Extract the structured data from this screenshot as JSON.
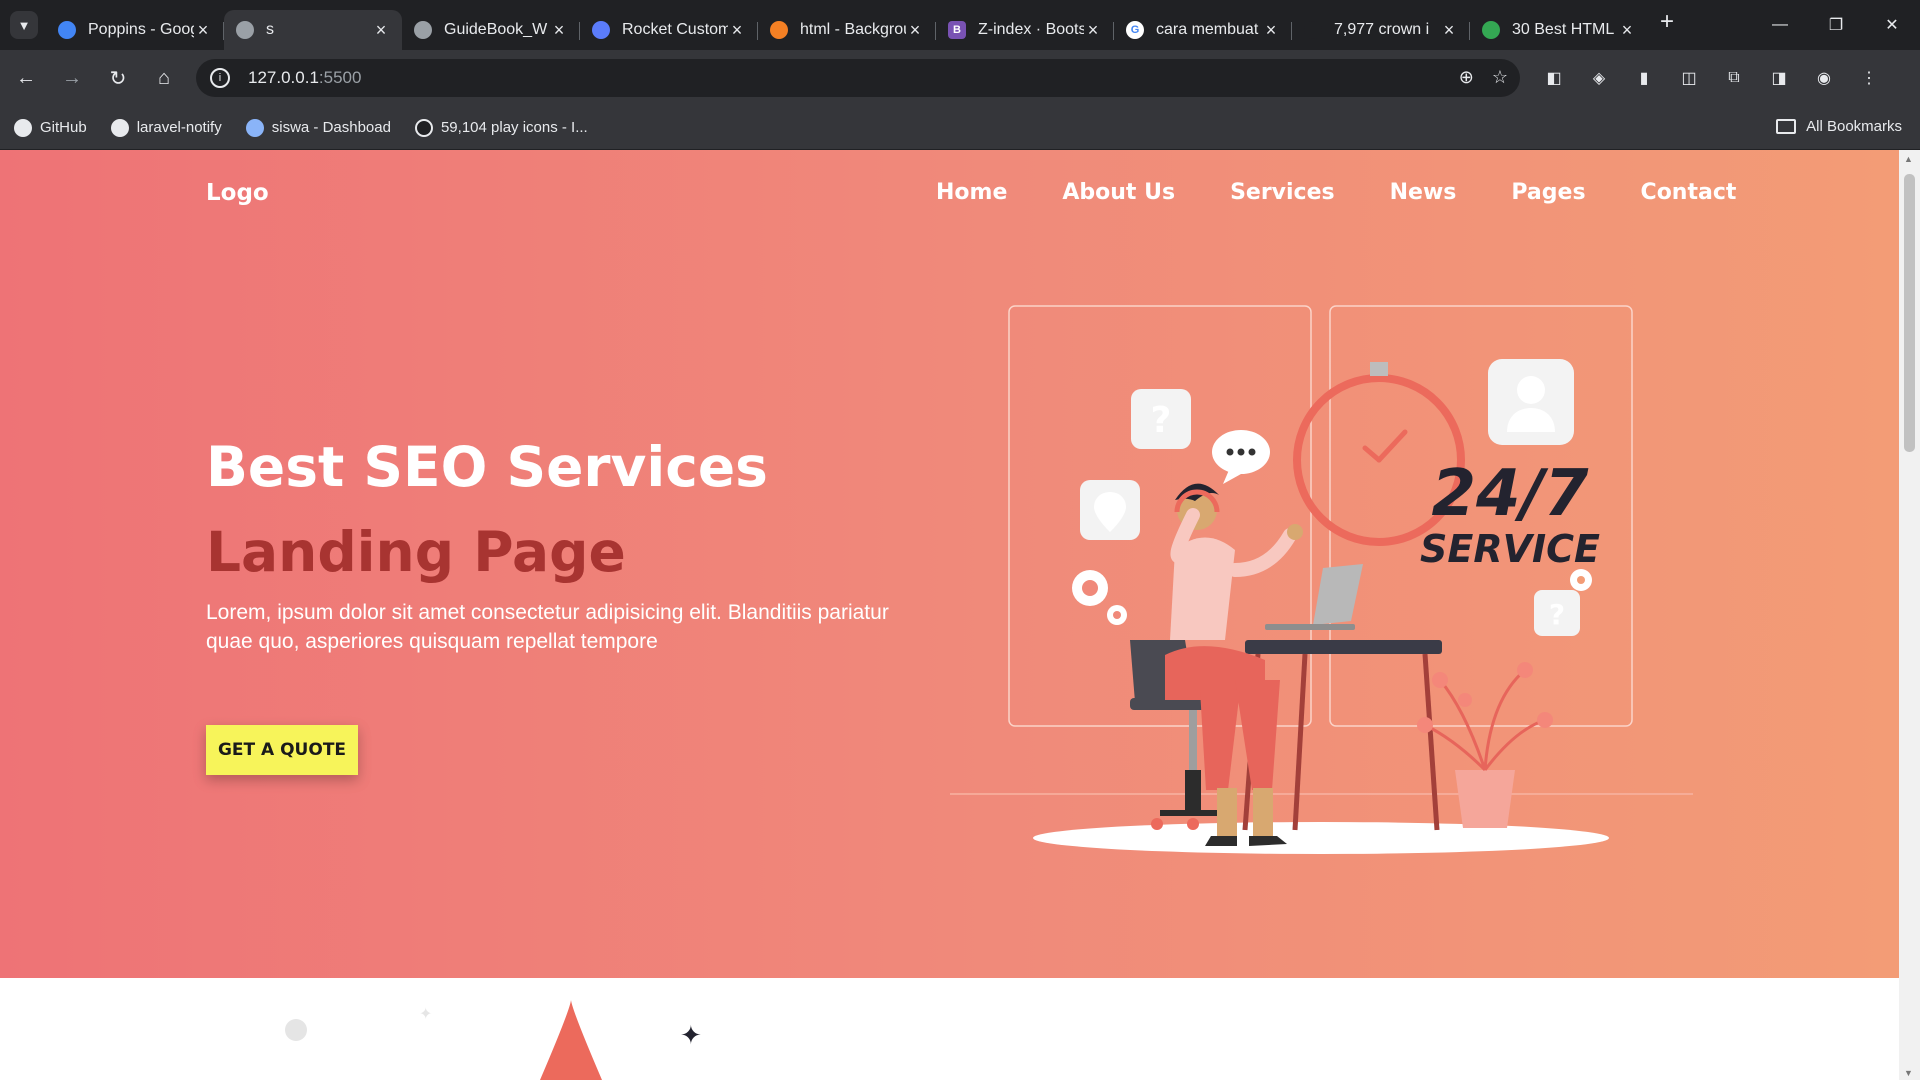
{
  "browser": {
    "tabs": [
      {
        "title": "Poppins - Google Fonts",
        "icon": "google-fonts-icon",
        "color": "#4285f4"
      },
      {
        "title": "s",
        "icon": "globe-icon",
        "color": "#9aa0a6",
        "active": true
      },
      {
        "title": "GuideBook_W",
        "icon": "globe-icon",
        "color": "#9aa0a6"
      },
      {
        "title": "Rocket Custom",
        "icon": "rocket-icon",
        "color": "#5b7cfa"
      },
      {
        "title": "html - Background",
        "icon": "stackoverflow-icon",
        "color": "#f48024"
      },
      {
        "title": "Z-index · Bootstrap",
        "icon": "bootstrap-icon",
        "color": "#7952b3"
      },
      {
        "title": "cara membuat",
        "icon": "google-icon",
        "color": "#ffffff"
      },
      {
        "title": "7,977 crown i",
        "icon": "crown-icon",
        "color": "#202124"
      },
      {
        "title": "30 Best HTML",
        "icon": "colorlib-icon",
        "color": "#34a853"
      }
    ],
    "url_host": "127.0.0.1",
    "url_port": ":5500",
    "bookmarks": [
      "GitHub",
      "laravel-notify",
      "siswa - Dashboad",
      "59,104 play icons - I..."
    ],
    "all_bookmarks": "All Bookmarks"
  },
  "site": {
    "logo": "Logo",
    "nav": [
      "Home",
      "About Us",
      "Services",
      "News",
      "Pages",
      "Contact"
    ],
    "headline": "Best SEO Services",
    "headline_accent": "Landing Page",
    "lead": "Lorem, ipsum dolor sit amet consectetur adipisicing elit. Blanditiis pariatur quae quo, asperiores quisquam repellat tempore",
    "cta": "GET A QUOTE",
    "illustration": {
      "service_big": "24/7",
      "service_small": "SERVICE"
    },
    "colors": {
      "gradient_start": "#ee7376",
      "gradient_end": "#f39c76",
      "accent": "#a83431",
      "cta": "#f7f45a"
    }
  }
}
